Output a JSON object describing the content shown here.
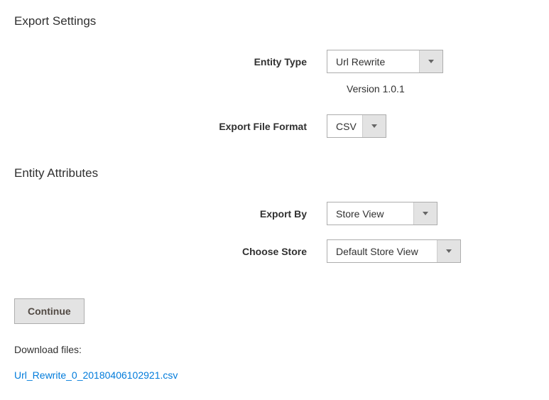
{
  "sections": {
    "export_settings": {
      "title": "Export Settings",
      "entity_type": {
        "label": "Entity Type",
        "value": "Url Rewrite"
      },
      "version": "Version 1.0.1",
      "export_file_format": {
        "label": "Export File Format",
        "value": "CSV"
      }
    },
    "entity_attributes": {
      "title": "Entity Attributes",
      "export_by": {
        "label": "Export By",
        "value": "Store View"
      },
      "choose_store": {
        "label": "Choose Store",
        "value": "Default Store View"
      }
    }
  },
  "continue_button": "Continue",
  "download": {
    "label": "Download files:",
    "link_text": "Url_Rewrite_0_20180406102921.csv"
  }
}
